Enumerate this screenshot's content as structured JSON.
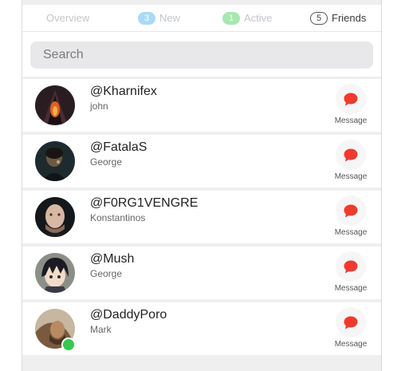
{
  "tabs": {
    "overview": {
      "label": "Overview"
    },
    "new": {
      "label": "New",
      "count": "3"
    },
    "active": {
      "label": "Active",
      "count": "1"
    },
    "friends": {
      "label": "Friends",
      "count": "5"
    }
  },
  "search": {
    "placeholder": "Search"
  },
  "message_label": "Message",
  "friends": [
    {
      "handle": "@Kharnifex",
      "name": "john",
      "online": false
    },
    {
      "handle": "@FatalaS",
      "name": "George",
      "online": false
    },
    {
      "handle": "@F0RG1VENGRE",
      "name": "Konstantinos",
      "online": false
    },
    {
      "handle": "@Mush",
      "name": "George",
      "online": false
    },
    {
      "handle": "@DaddyPoro",
      "name": "Mark",
      "online": true
    }
  ],
  "colors": {
    "message_icon": "#f03a2e",
    "online": "#37c84f"
  }
}
